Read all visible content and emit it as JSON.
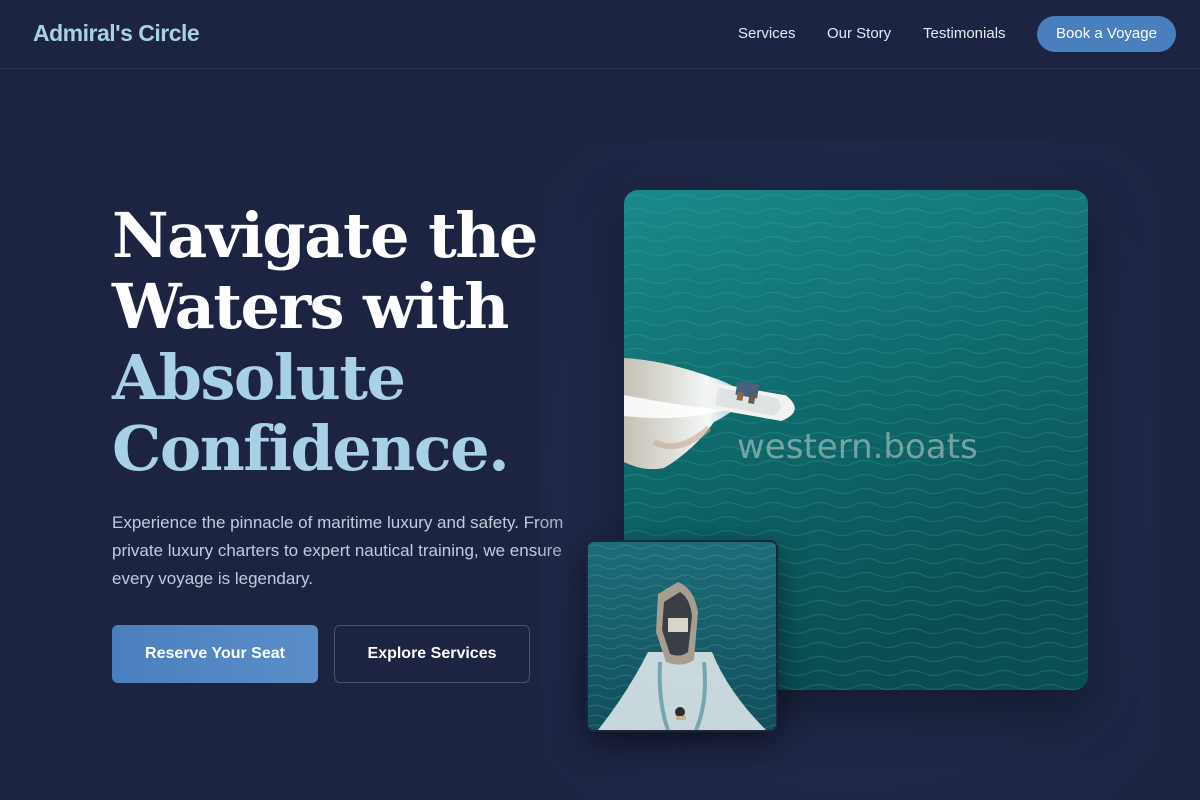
{
  "header": {
    "brand": "Admiral's Circle",
    "nav": [
      "Services",
      "Our Story",
      "Testimonials"
    ],
    "cta": "Book a Voyage"
  },
  "hero": {
    "title_lines": [
      "Navigate the",
      "Waters with"
    ],
    "title_accent_lines": [
      "Absolute",
      "Confidence."
    ],
    "subtitle": "Experience the pinnacle of maritime luxury and safety. From private luxury charters to expert nautical training, we ensure every voyage is legendary.",
    "primary_button": "Reserve Your Seat",
    "secondary_button": "Explore Services"
  },
  "images": {
    "main": {
      "subject": "aerial view of speedboat on teal water",
      "watermark": "western.boats"
    },
    "secondary": {
      "subject": "aerial view of boat towing a wakeboarder"
    }
  },
  "colors": {
    "background": "#1c2442",
    "brand": "#a8d0e6",
    "accent": "#4a7fbd",
    "water": "#0f6468"
  }
}
